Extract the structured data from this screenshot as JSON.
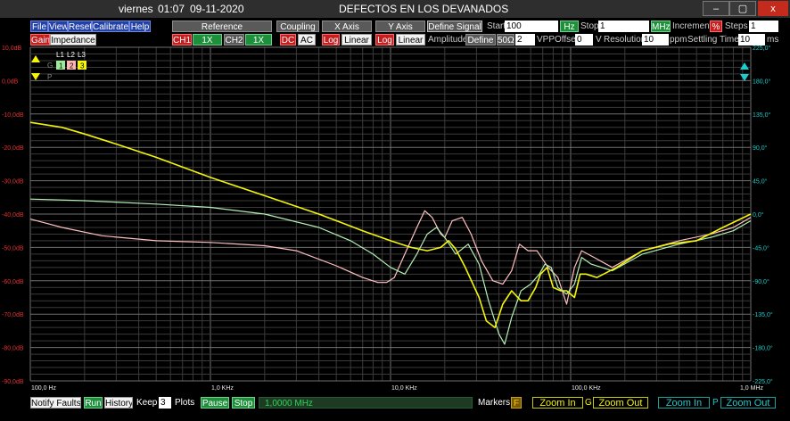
{
  "titlebar": {
    "day": "viernes",
    "time": "01:07",
    "date": "09-11-2020",
    "title": "DEFECTOS EN LOS DEVANADOS",
    "minimize_label": "–",
    "restore_label": "▢",
    "close_label": "x"
  },
  "menu": {
    "file": "File",
    "view": "View",
    "reset": "Reset",
    "calibrate": "Calibrate",
    "help": "Help"
  },
  "tabs": {
    "reference": "Reference",
    "coupling": "Coupling",
    "xaxis": "X Axis",
    "yaxis": "Y Axis"
  },
  "signal": {
    "define_signal": "Define Signal",
    "start_label": "Start",
    "start_value": "100",
    "start_unit": "Hz",
    "stop_label": "Stop",
    "stop_value": "1",
    "stop_unit": "MHz",
    "increment_label": "Increment",
    "increment_unit": "%",
    "steps_label": "Steps",
    "steps_value": "1"
  },
  "row3": {
    "gain": "Gain",
    "impedance": "Impedance",
    "ch1": "CH1",
    "ch1x": "1X",
    "ch2": "CH2",
    "ch2x": "1X",
    "dc": "DC",
    "ac": "AC",
    "x_log": "Log",
    "x_linear": "Linear",
    "y_log": "Log",
    "y_linear": "Linear",
    "amplitude_label": "Amplitude",
    "define": "Define",
    "impedance_value": "50Ω",
    "amplitude_value": "2",
    "amplitude_unit": "VPP",
    "offset_label": "Offset",
    "offset_value": "0",
    "offset_unit": "V",
    "resolution_label": "Resolution",
    "resolution_value": "10",
    "resolution_unit": "ppm",
    "settling_label": "Settling Time",
    "settling_value": "10",
    "settling_unit": "ms"
  },
  "legend": {
    "l1": "L1",
    "l2": "L2",
    "l3": "L3",
    "n1": "1",
    "n2": "2",
    "n3": "3",
    "g": "G",
    "p": "P"
  },
  "bottom": {
    "notify": "Notify Faults",
    "run": "Run",
    "history": "History",
    "keep_label": "Keep",
    "keep_value": "3",
    "plots_label": "Plots",
    "pause": "Pause",
    "stop": "Stop",
    "freq_display": "1,0000 MHz",
    "markers_label": "Markers",
    "markers_toggle": "F",
    "zoom_in_1": "Zoom In",
    "g_label": "G",
    "zoom_out_1": "Zoom Out",
    "zoom_in_2": "Zoom In",
    "p_label": "P",
    "zoom_out_2": "Zoom Out"
  },
  "colors": {
    "L1": "#ffc0c0",
    "L2": "#b4f0b4",
    "L3": "#f5f50a",
    "left_axis": "#e03232",
    "right_axis": "#1ecbcb"
  },
  "chart_data": {
    "type": "line",
    "xlabel": "",
    "ylabel": "",
    "x_scale": "log",
    "x_ticks": [
      "100,0 Hz",
      "1,0 KHz",
      "10,0 KHz",
      "100,0 KHz",
      "1,0 MHz"
    ],
    "y_left_ticks": [
      "10,0dB",
      "0,0dB",
      "-10,0dB",
      "-20,0dB",
      "-30,0dB",
      "-40,0dB",
      "-50,0dB",
      "-60,0dB",
      "-70,0dB",
      "-80,0dB",
      "-90,0dB"
    ],
    "y_right_ticks": [
      "225,0°",
      "180,0°",
      "135,0°",
      "90,0°",
      "45,0°",
      "0,0°",
      "-45,0°",
      "-90,0°",
      "-135,0°",
      "-180,0°",
      "-225,0°"
    ],
    "ylim": [
      -90,
      10
    ],
    "xlim": [
      100,
      1000000
    ],
    "grid": true,
    "series": [
      {
        "name": "L1",
        "color": "#ffc0c0",
        "points": [
          [
            100,
            -41.5
          ],
          [
            150,
            -44
          ],
          [
            250,
            -46.5
          ],
          [
            500,
            -48
          ],
          [
            1000,
            -48.5
          ],
          [
            2000,
            -49.5
          ],
          [
            3000,
            -51
          ],
          [
            5000,
            -55.5
          ],
          [
            7000,
            -59
          ],
          [
            8500,
            -60.5
          ],
          [
            9500,
            -60.5
          ],
          [
            10500,
            -59
          ],
          [
            12000,
            -52
          ],
          [
            14000,
            -44
          ],
          [
            15500,
            -39
          ],
          [
            17000,
            -41
          ],
          [
            19000,
            -46
          ],
          [
            20000,
            -47
          ],
          [
            22000,
            -42
          ],
          [
            25000,
            -41
          ],
          [
            28000,
            -46
          ],
          [
            32000,
            -54
          ],
          [
            37000,
            -60
          ],
          [
            42000,
            -61
          ],
          [
            47000,
            -57
          ],
          [
            52000,
            -49
          ],
          [
            58000,
            -51
          ],
          [
            65000,
            -51
          ],
          [
            75000,
            -56
          ],
          [
            85000,
            -59
          ],
          [
            95000,
            -67
          ],
          [
            105000,
            -56
          ],
          [
            115000,
            -51
          ],
          [
            135000,
            -53
          ],
          [
            170000,
            -56
          ],
          [
            250000,
            -51
          ],
          [
            400000,
            -48
          ],
          [
            600000,
            -46
          ],
          [
            800000,
            -44
          ],
          [
            1000000,
            -41
          ]
        ]
      },
      {
        "name": "L2",
        "color": "#b4f0b4",
        "points": [
          [
            100,
            -35.5
          ],
          [
            200,
            -36
          ],
          [
            500,
            -37
          ],
          [
            1000,
            -38
          ],
          [
            2000,
            -40
          ],
          [
            4000,
            -44
          ],
          [
            6000,
            -48
          ],
          [
            8000,
            -52
          ],
          [
            10000,
            -56
          ],
          [
            12000,
            -58
          ],
          [
            14000,
            -52
          ],
          [
            16000,
            -46
          ],
          [
            18000,
            -44
          ],
          [
            20000,
            -47
          ],
          [
            23000,
            -52
          ],
          [
            27000,
            -49
          ],
          [
            31000,
            -55
          ],
          [
            35000,
            -66
          ],
          [
            40000,
            -76
          ],
          [
            43000,
            -79
          ],
          [
            47000,
            -71
          ],
          [
            53000,
            -63
          ],
          [
            60000,
            -61
          ],
          [
            67000,
            -58
          ],
          [
            72000,
            -55
          ],
          [
            78000,
            -56
          ],
          [
            85000,
            -62
          ],
          [
            95000,
            -64
          ],
          [
            105000,
            -61
          ],
          [
            115000,
            -53
          ],
          [
            130000,
            -55
          ],
          [
            170000,
            -57
          ],
          [
            250000,
            -52
          ],
          [
            400000,
            -49
          ],
          [
            600000,
            -47
          ],
          [
            800000,
            -45
          ],
          [
            1000000,
            -42
          ]
        ]
      },
      {
        "name": "L3",
        "color": "#f5f50a",
        "points": [
          [
            100,
            -12.5
          ],
          [
            150,
            -14
          ],
          [
            200,
            -16
          ],
          [
            300,
            -19
          ],
          [
            500,
            -23
          ],
          [
            1000,
            -29
          ],
          [
            2000,
            -34.5
          ],
          [
            4000,
            -40
          ],
          [
            7000,
            -45
          ],
          [
            10000,
            -48
          ],
          [
            13000,
            -50
          ],
          [
            16000,
            -51
          ],
          [
            19000,
            -50
          ],
          [
            21000,
            -48
          ],
          [
            23000,
            -50.5
          ],
          [
            26000,
            -56
          ],
          [
            31000,
            -65
          ],
          [
            34000,
            -72
          ],
          [
            38000,
            -74
          ],
          [
            42000,
            -67
          ],
          [
            47000,
            -63
          ],
          [
            53000,
            -66
          ],
          [
            58000,
            -66
          ],
          [
            64000,
            -62
          ],
          [
            68000,
            -58
          ],
          [
            74000,
            -56
          ],
          [
            80000,
            -62
          ],
          [
            88000,
            -63
          ],
          [
            95000,
            -63
          ],
          [
            105000,
            -65
          ],
          [
            113000,
            -58
          ],
          [
            122000,
            -58
          ],
          [
            140000,
            -59
          ],
          [
            180000,
            -56
          ],
          [
            250000,
            -51
          ],
          [
            350000,
            -49
          ],
          [
            500000,
            -48
          ],
          [
            700000,
            -44
          ],
          [
            1000000,
            -40
          ]
        ]
      }
    ]
  }
}
